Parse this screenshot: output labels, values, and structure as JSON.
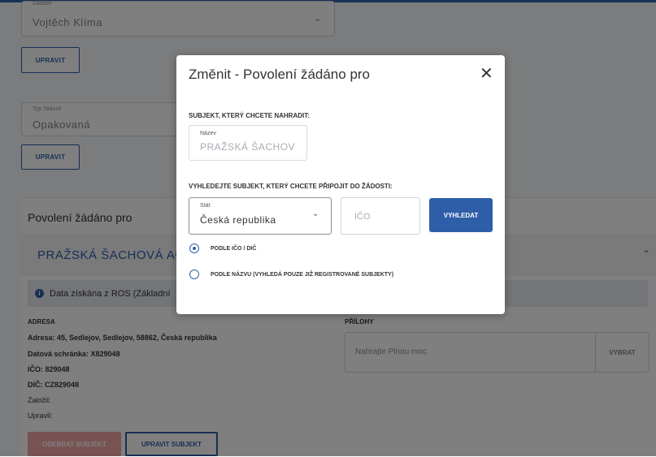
{
  "background": {
    "requester": {
      "label": "Žadatel",
      "value": "Vojtěch Klíma"
    },
    "edit_button_1": "UPRAVIT",
    "request_type": {
      "label": "Typ žádosti",
      "value": "Opakovaná"
    },
    "edit_button_2": "UPRAVIT",
    "section_title": "Povolení žádáno pro",
    "organization_name": "PRAŽSKÁ ŠACHOVÁ AGE",
    "info_text": "Data získána z ROS (Základní",
    "address_heading": "ADRESA",
    "address_lines": [
      "Adresa: 45, Sedlejov, Sedlejov, 58862, Česká republika",
      "Datová schránka: X829048",
      "IČO: 829048",
      "DIČ: CZ829048",
      "Založil:",
      "Upravil:"
    ],
    "attachments_heading": "PŘÍLOHY",
    "upload_placeholder": "Nahrajte Plnou moc",
    "upload_pick": "VYBRAT",
    "remove_button": "ODEBRAT SUBJEKT",
    "edit_subject_button": "UPRAVIT SUBJEKT"
  },
  "modal": {
    "title": "Změnit - Povolení žádáno pro",
    "close_icon": "close-icon",
    "replace_heading": "SUBJEKT, KTERÝ CHCETE NAHRADIT:",
    "name_field": {
      "label": "Název",
      "value": "PRAŽSKÁ ŠACHOV"
    },
    "search_heading": "VYHLEDEJTE SUBJEKT, KTERÝ CHCETE PŘIPOJIT DO ŽÁDOSTI:",
    "country_field": {
      "label": "Stát",
      "value": "Česká republika"
    },
    "ico_placeholder": "IČO",
    "search_button": "VYHLEDAT",
    "radio_options": [
      {
        "label": "PODLE IČO / DIČ",
        "selected": true
      },
      {
        "label": "PODLE NÁZVU (VYHLEDÁ POUZE JIŽ REGISTROVANÉ SUBJEKTY)",
        "selected": false
      }
    ]
  },
  "colors": {
    "primary": "#2f5ea8",
    "danger_disabled": "#f0a6a6"
  }
}
